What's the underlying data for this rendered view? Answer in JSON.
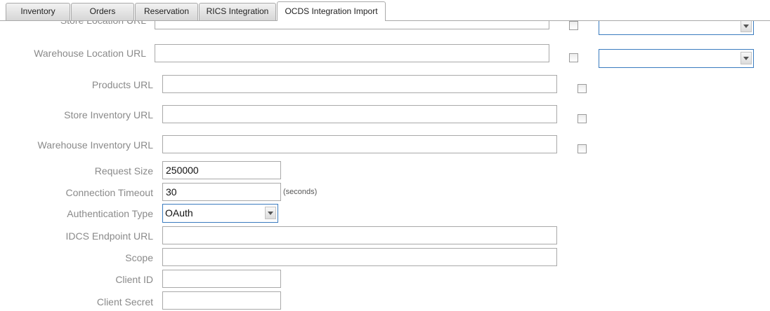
{
  "tabs": [
    {
      "label": "Inventory"
    },
    {
      "label": "Orders"
    },
    {
      "label": "Reservation"
    },
    {
      "label": "RICS Integration"
    },
    {
      "label": "OCDS Integration Import",
      "active": true
    }
  ],
  "form": {
    "store_location_url": {
      "label": "Store Location URL",
      "value": ""
    },
    "warehouse_location_url": {
      "label": "Warehouse Location URL",
      "value": ""
    },
    "products_url": {
      "label": "Products URL",
      "value": ""
    },
    "store_inventory_url": {
      "label": "Store Inventory URL",
      "value": ""
    },
    "warehouse_inventory_url": {
      "label": "Warehouse Inventory URL",
      "value": ""
    },
    "request_size": {
      "label": "Request Size",
      "value": "250000"
    },
    "connection_timeout": {
      "label": "Connection Timeout",
      "value": "30",
      "unit": "(seconds)"
    },
    "authentication_type": {
      "label": "Authentication Type",
      "value": "OAuth"
    },
    "idcs_endpoint_url": {
      "label": "IDCS Endpoint URL",
      "value": ""
    },
    "scope": {
      "label": "Scope",
      "value": ""
    },
    "client_id": {
      "label": "Client ID",
      "value": ""
    },
    "client_secret": {
      "label": "Client Secret",
      "value": ""
    }
  },
  "colors": {
    "select_border": "#3a7bbf",
    "label_text": "#8a8a8a"
  }
}
